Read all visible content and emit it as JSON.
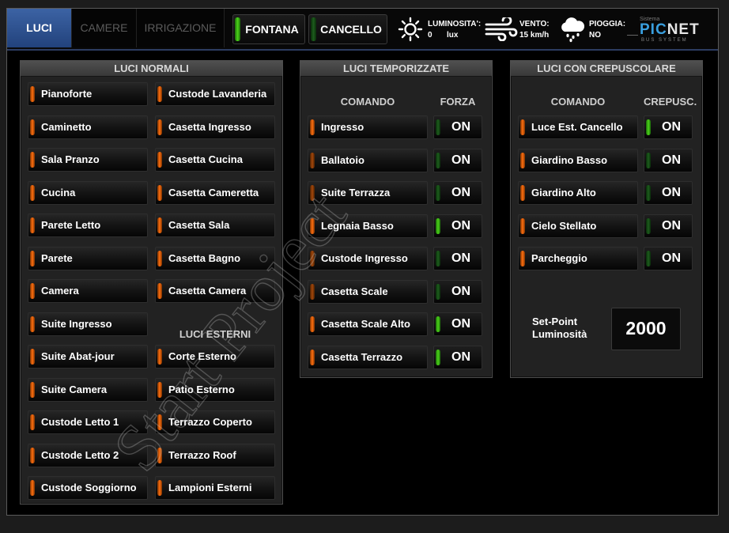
{
  "tabs": [
    {
      "label": "LUCI",
      "active": true
    },
    {
      "label": "CAMERE",
      "active": false
    },
    {
      "label": "IRRIGAZIONE",
      "active": false
    }
  ],
  "top_buttons": [
    {
      "label": "FONTANA",
      "led": "green"
    },
    {
      "label": "CANCELLO",
      "led": "off"
    }
  ],
  "weather": {
    "luminosity": {
      "label": "LUMINOSITA':",
      "value": "0",
      "unit": "lux",
      "icon": "sun-icon"
    },
    "wind": {
      "label": "VENTO:",
      "value": "15 km/h",
      "icon": "wind-icon"
    },
    "rain": {
      "label": "PIOGGIA:",
      "value": "NO",
      "icon": "cloud-rain-icon"
    }
  },
  "logo": {
    "brand_pre": "PIC",
    "brand_post": "NET",
    "tag": "BUS SYSTEM",
    "small": "Sistema"
  },
  "luci_normali": {
    "title": "LUCI NORMALI",
    "col1": [
      "Pianoforte",
      "Caminetto",
      "Sala Pranzo",
      "Cucina",
      "Parete Letto",
      "Parete",
      "Camera",
      "Suite Ingresso",
      "Suite Abat-jour",
      "Suite Camera",
      "Custode Letto 1",
      "Custode Letto 2",
      "Custode Soggiorno"
    ],
    "col2": [
      "Custode Lavanderia",
      "Casetta Ingresso",
      "Casetta Cucina",
      "Casetta Cameretta",
      "Casetta Sala",
      "Casetta Bagno",
      "Casetta Camera"
    ],
    "esterni_title": "LUCI ESTERNI",
    "esterni": [
      "Corte Esterno",
      "Patio Esterno",
      "Terrazzo Coperto",
      "Terrazzo Roof",
      "Lampioni Esterni"
    ]
  },
  "luci_temporizzate": {
    "title": "LUCI TEMPORIZZATE",
    "header_cmd": "COMANDO",
    "header_force": "FORZA",
    "rows": [
      {
        "label": "Ingresso",
        "on": "ON",
        "lit": false,
        "led_lit": true
      },
      {
        "label": "Ballatoio",
        "on": "ON",
        "lit": false,
        "led_lit": false
      },
      {
        "label": "Suite Terrazza",
        "on": "ON",
        "lit": false,
        "led_lit": false
      },
      {
        "label": "Legnaia Basso",
        "on": "ON",
        "lit": true,
        "led_lit": true
      },
      {
        "label": "Custode Ingresso",
        "on": "ON",
        "lit": false,
        "led_lit": false
      },
      {
        "label": "Casetta Scale",
        "on": "ON",
        "lit": false,
        "led_lit": false
      },
      {
        "label": "Casetta Scale Alto",
        "on": "ON",
        "lit": true,
        "led_lit": true
      },
      {
        "label": "Casetta Terrazzo",
        "on": "ON",
        "lit": true,
        "led_lit": true
      }
    ]
  },
  "luci_crepuscolare": {
    "title": "LUCI CON CREPUSCOLARE",
    "header_cmd": "COMANDO",
    "header_crep": "CREPUSC.",
    "rows": [
      {
        "label": "Luce Est. Cancello",
        "on": "ON",
        "lit": true
      },
      {
        "label": "Giardino Basso",
        "on": "ON",
        "lit": false
      },
      {
        "label": "Giardino Alto",
        "on": "ON",
        "lit": false
      },
      {
        "label": "Cielo Stellato",
        "on": "ON",
        "lit": false
      },
      {
        "label": "Parcheggio",
        "on": "ON",
        "lit": false
      }
    ],
    "setpoint_label_1": "Set-Point",
    "setpoint_label_2": "Luminosità",
    "setpoint_value": "2000"
  },
  "watermark": "Start Project"
}
